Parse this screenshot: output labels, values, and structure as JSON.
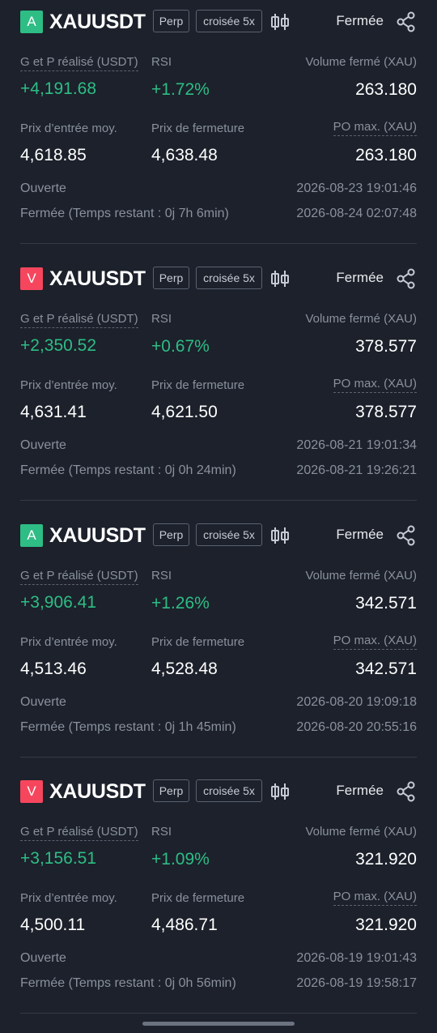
{
  "labels": {
    "pnl": "G et P réalisé (USDT)",
    "rsi": "RSI",
    "closed_volume": "Volume fermé (XAU)",
    "entry_price": "Prix d’entrée moy.",
    "close_price": "Prix de fermeture",
    "max_po": "PO max. (XAU)",
    "opened": "Ouverte"
  },
  "colors": {
    "background": "#1c212b",
    "long": "#2ebd85",
    "short": "#f6465d",
    "profit": "#2ebd85",
    "muted": "#8a919d"
  },
  "icons": {
    "chart": "candlestick-chart-icon",
    "share": "share-icon"
  },
  "positions": [
    {
      "side": "A",
      "side_type": "long",
      "symbol": "XAUUSDT",
      "contract": "Perp",
      "margin": "croisée 5x",
      "status": "Fermée",
      "pnl": "+4,191.68",
      "rsi": "+1.72%",
      "closed_volume": "263.180",
      "entry_price": "4,618.85",
      "close_price": "4,638.48",
      "max_po": "263.180",
      "opened_time": "2026-08-23 19:01:46",
      "closed_label": "Fermée (Temps restant : 0j 7h 6min)",
      "closed_time": "2026-08-24 02:07:48"
    },
    {
      "side": "V",
      "side_type": "short",
      "symbol": "XAUUSDT",
      "contract": "Perp",
      "margin": "croisée 5x",
      "status": "Fermée",
      "pnl": "+2,350.52",
      "rsi": "+0.67%",
      "closed_volume": "378.577",
      "entry_price": "4,631.41",
      "close_price": "4,621.50",
      "max_po": "378.577",
      "opened_time": "2026-08-21 19:01:34",
      "closed_label": "Fermée (Temps restant : 0j 0h 24min)",
      "closed_time": "2026-08-21 19:26:21"
    },
    {
      "side": "A",
      "side_type": "long",
      "symbol": "XAUUSDT",
      "contract": "Perp",
      "margin": "croisée 5x",
      "status": "Fermée",
      "pnl": "+3,906.41",
      "rsi": "+1.26%",
      "closed_volume": "342.571",
      "entry_price": "4,513.46",
      "close_price": "4,528.48",
      "max_po": "342.571",
      "opened_time": "2026-08-20 19:09:18",
      "closed_label": "Fermée (Temps restant : 0j 1h 45min)",
      "closed_time": "2026-08-20 20:55:16"
    },
    {
      "side": "V",
      "side_type": "short",
      "symbol": "XAUUSDT",
      "contract": "Perp",
      "margin": "croisée 5x",
      "status": "Fermée",
      "pnl": "+3,156.51",
      "rsi": "+1.09%",
      "closed_volume": "321.920",
      "entry_price": "4,500.11",
      "close_price": "4,486.71",
      "max_po": "321.920",
      "opened_time": "2026-08-19 19:01:43",
      "closed_label": "Fermée (Temps restant : 0j 0h 56min)",
      "closed_time": "2026-08-19 19:58:17"
    }
  ]
}
